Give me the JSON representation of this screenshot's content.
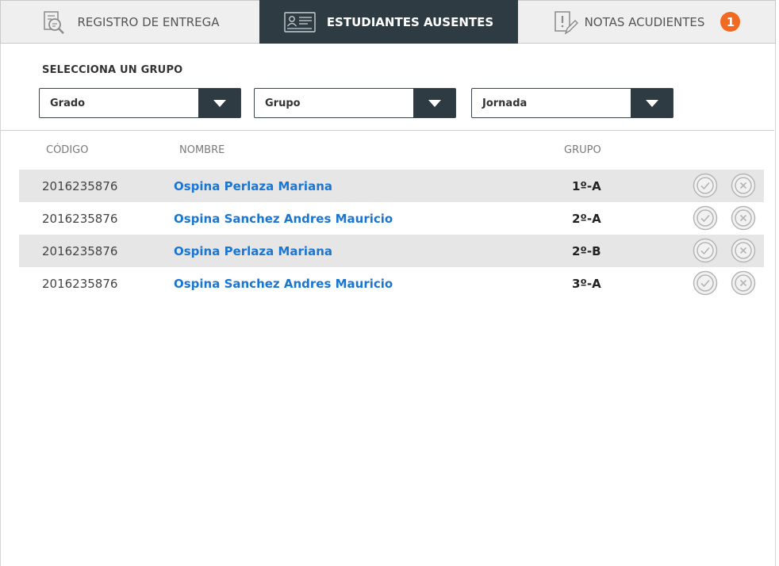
{
  "tabs": [
    {
      "label": "REGISTRO DE ENTREGA",
      "icon": "document-search-icon"
    },
    {
      "label": "ESTUDIANTES AUSENTES",
      "icon": "id-card-icon",
      "active": true
    },
    {
      "label": "NOTAS ACUDIENTES",
      "icon": "note-alert-icon",
      "badge": "1"
    }
  ],
  "filters": {
    "label": "SELECCIONA UN GRUPO",
    "grado": "Grado",
    "grupo": "Grupo",
    "jornada": "Jornada"
  },
  "table": {
    "headers": {
      "codigo": "CÓDIGO",
      "nombre": "NOMBRE",
      "grupo": "GRUPO"
    },
    "rows": [
      {
        "codigo": "2016235876",
        "nombre": "Ospina Perlaza Mariana",
        "grupo": "1º-A"
      },
      {
        "codigo": "2016235876",
        "nombre": "Ospina Sanchez Andres Mauricio",
        "grupo": "2º-A"
      },
      {
        "codigo": "2016235876",
        "nombre": "Ospina Perlaza Mariana",
        "grupo": "2º-B"
      },
      {
        "codigo": "2016235876",
        "nombre": "Ospina Sanchez Andres Mauricio",
        "grupo": "3º-A"
      }
    ]
  },
  "colors": {
    "dark": "#2f3b42",
    "link": "#1b76d1",
    "badge": "#f26a21",
    "row_alt": "#e6e6e6"
  }
}
